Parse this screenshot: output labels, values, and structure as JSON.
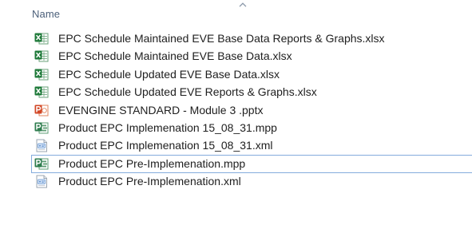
{
  "header": {
    "column_name": "Name",
    "sort_indicator": "chevron-up-icon"
  },
  "files": [
    {
      "name": "EPC Schedule Maintained EVE Base Data Reports & Graphs.xlsx",
      "type": "excel",
      "icon": "excel-file-icon",
      "selected": false
    },
    {
      "name": "EPC Schedule Maintained EVE Base Data.xlsx",
      "type": "excel",
      "icon": "excel-file-icon",
      "selected": false
    },
    {
      "name": "EPC Schedule Updated EVE Base Data.xlsx",
      "type": "excel",
      "icon": "excel-file-icon",
      "selected": false
    },
    {
      "name": "EPC Schedule Updated EVE Reports & Graphs.xlsx",
      "type": "excel",
      "icon": "excel-file-icon",
      "selected": false
    },
    {
      "name": "EVENGINE STANDARD  - Module 3 .pptx",
      "type": "powerpoint",
      "icon": "powerpoint-file-icon",
      "selected": false
    },
    {
      "name": "Product EPC Implemenation 15_08_31.mpp",
      "type": "project",
      "icon": "project-file-icon",
      "selected": false
    },
    {
      "name": "Product EPC Implemenation 15_08_31.xml",
      "type": "xml",
      "icon": "xml-file-icon",
      "selected": false
    },
    {
      "name": "Product EPC Pre-Implemenation.mpp",
      "type": "project",
      "icon": "project-file-icon",
      "selected": true
    },
    {
      "name": "Product EPC Pre-Implemenation.xml",
      "type": "xml",
      "icon": "xml-file-icon",
      "selected": false
    }
  ],
  "colors": {
    "header_text": "#4c607a",
    "selection_border": "#84acdd",
    "excel": "#1f7a3a",
    "powerpoint": "#d24726",
    "project": "#2f7d4f",
    "xml": "#5a8fd0"
  }
}
